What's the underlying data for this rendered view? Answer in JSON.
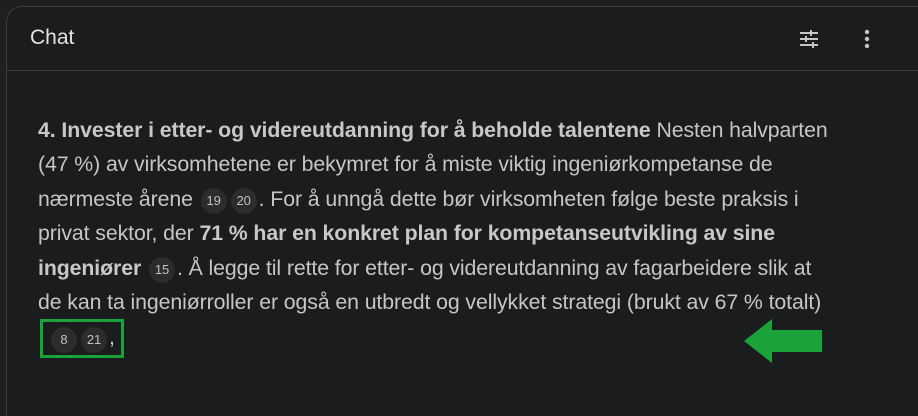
{
  "header": {
    "title": "Chat"
  },
  "icons": {
    "settings": "tune-icon",
    "more": "more-vertical-icon"
  },
  "message": {
    "heading": "4. Invester i etter- og videreutdanning for å beholde talentene",
    "text1": " Nesten halvparten (47 %) av virksomhetene er bekymret for å miste viktig ingeniørkompetanse de nærmeste årene ",
    "cite_a": "19",
    "cite_b": "20",
    "text2": ". For å unngå dette bør virksomheten følge beste praksis i privat sektor, der ",
    "bold2": "71 % har en konkret plan for kompetanseutvikling av sine ingeniører",
    "cite_c": "15",
    "text3": ". Å legge til rette for etter- og videreutdanning av fagarbeidere slik at de kan ta ingeniørroller er også en utbredt og vellykket strategi (brukt av 67 % totalt)",
    "cite_d": "8",
    "cite_e": "21",
    "trail": ","
  },
  "colors": {
    "highlight": "#19a33a",
    "background": "#1b1c1d",
    "text": "#c4c7c5"
  }
}
